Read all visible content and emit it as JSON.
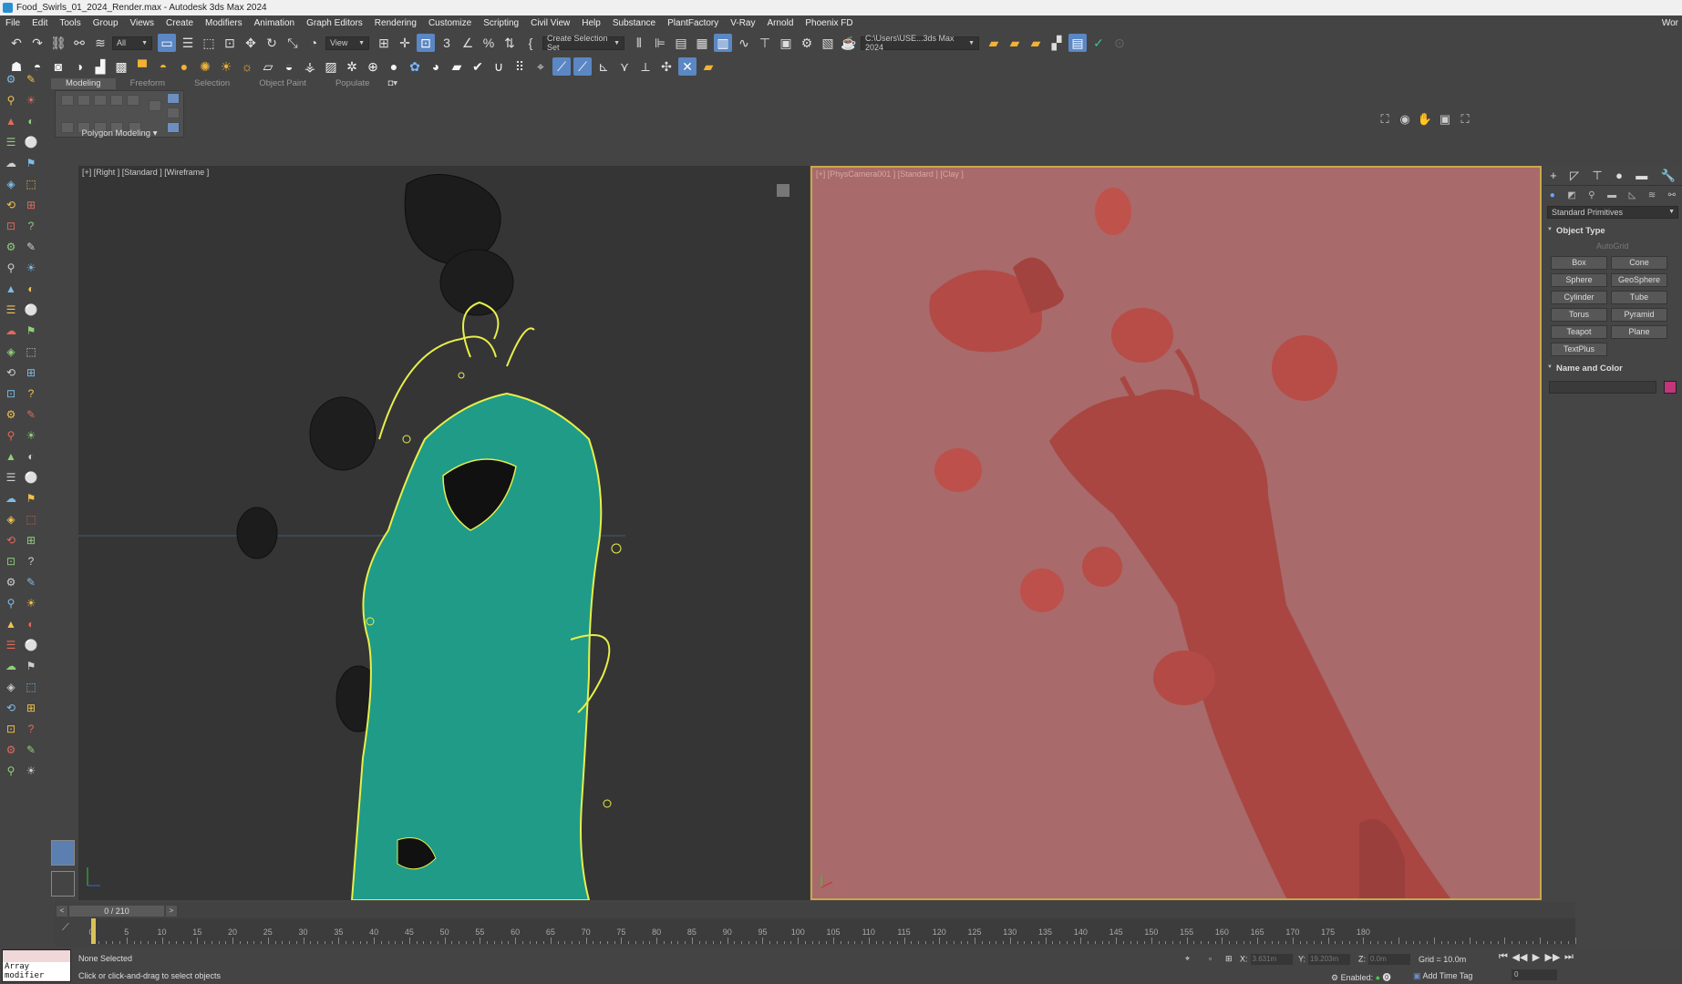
{
  "window": {
    "title": "Food_Swirls_01_2024_Render.max - Autodesk 3ds Max 2024"
  },
  "menu": {
    "items": [
      "File",
      "Edit",
      "Tools",
      "Group",
      "Views",
      "Create",
      "Modifiers",
      "Animation",
      "Graph Editors",
      "Rendering",
      "Customize",
      "Scripting",
      "Civil View",
      "Help",
      "Substance",
      "PlantFactory",
      "V-Ray",
      "Arnold",
      "Phoenix FD"
    ],
    "right_text": "Wor"
  },
  "toolbar": {
    "selection_filter": "All",
    "ref_coord": "View",
    "named_selection": "Create Selection Set",
    "project_path": "C:\\Users\\USE...3ds Max 2024"
  },
  "ribbon": {
    "tabs": [
      "Modeling",
      "Freeform",
      "Selection",
      "Object Paint",
      "Populate"
    ],
    "active_tab": "Modeling",
    "panel_label": "Polygon Modeling"
  },
  "viewports": {
    "left_label": "[+] [Right ] [Standard ] [Wireframe ]",
    "right_label": "[+] [PhysCamera001 ] [Standard ] [Clay ]"
  },
  "command_panel": {
    "category": "Standard Primitives",
    "object_type_title": "Object Type",
    "autogrid": "AutoGrid",
    "primitives": [
      "Box",
      "Cone",
      "Sphere",
      "GeoSphere",
      "Cylinder",
      "Tube",
      "Torus",
      "Pyramid",
      "Teapot",
      "Plane",
      "TextPlus"
    ],
    "name_color_title": "Name and Color",
    "color": "#c2357a"
  },
  "timeline": {
    "frame_display": "0 / 210",
    "current_frame": 0,
    "start": 0,
    "end": 210,
    "tick_labels": [
      "0",
      "5",
      "10",
      "15",
      "20",
      "25",
      "30",
      "35",
      "40",
      "45",
      "50",
      "55",
      "60",
      "65",
      "70",
      "75",
      "80",
      "85",
      "90",
      "95",
      "100",
      "105",
      "110",
      "115",
      "120",
      "125",
      "130",
      "135",
      "140",
      "145",
      "150",
      "155",
      "160",
      "165",
      "170",
      "175",
      "180"
    ]
  },
  "status": {
    "maxscript_listener": "Array modifier",
    "selection": "None Selected",
    "prompt": "Click or click-and-drag to select objects",
    "x_label": "X:",
    "x_value": "3.631m",
    "y_label": "Y:",
    "y_value": "19.203m",
    "z_label": "Z:",
    "z_value": "0.0m",
    "grid": "Grid = 10.0m",
    "enabled": "Enabled:",
    "add_time_tag": "Add Time Tag",
    "frame_field": "0"
  }
}
